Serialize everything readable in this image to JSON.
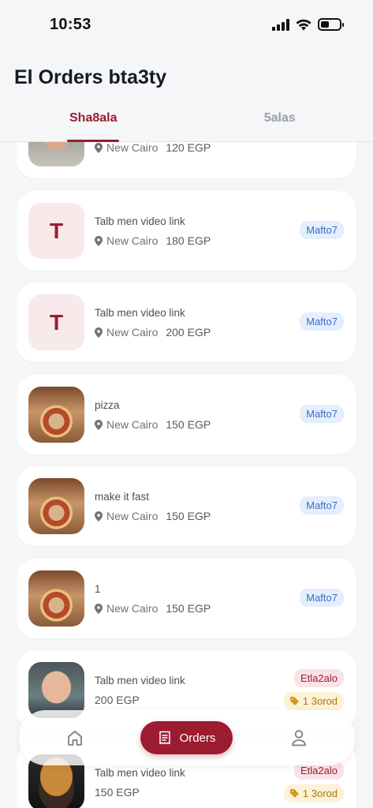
{
  "status_bar": {
    "time": "10:53"
  },
  "header": {
    "title": "El Orders bta3ty"
  },
  "tabs": [
    {
      "label": "Sha8ala",
      "active": true
    },
    {
      "label": "5alas",
      "active": false
    }
  ],
  "orders": [
    {
      "title": "",
      "location": "New Cairo",
      "price": "120 EGP",
      "thumb": "face",
      "status": "",
      "tag": ""
    },
    {
      "title": "Talb men video link",
      "location": "New Cairo",
      "price": "180 EGP",
      "thumb": "letter",
      "thumb_letter": "T",
      "status": "Mafto7",
      "tag": ""
    },
    {
      "title": "Talb men video link",
      "location": "New Cairo",
      "price": "200 EGP",
      "thumb": "letter",
      "thumb_letter": "T",
      "status": "Mafto7",
      "tag": ""
    },
    {
      "title": "pizza",
      "location": "New Cairo",
      "price": "150 EGP",
      "thumb": "pizza",
      "status": "Mafto7",
      "tag": ""
    },
    {
      "title": "make it fast",
      "location": "New Cairo",
      "price": "150 EGP",
      "thumb": "pizza",
      "status": "Mafto7",
      "tag": ""
    },
    {
      "title": "1",
      "location": "New Cairo",
      "price": "150 EGP",
      "thumb": "pizza",
      "status": "Mafto7",
      "tag": ""
    },
    {
      "title": "Talb men video link",
      "location": "",
      "price": "200 EGP",
      "thumb": "face",
      "status": "Etla2alo",
      "tag": "1 3orod"
    },
    {
      "title": "Talb men video link",
      "location": "",
      "price": "150 EGP",
      "thumb": "burger",
      "status": "Etla2alo",
      "tag": "1 3orod"
    }
  ],
  "bottom_nav": {
    "orders_label": "Orders"
  },
  "colors": {
    "accent": "#9b1c31",
    "open_badge": "#3a6fc4",
    "taken_badge": "#9b1c31",
    "offers_badge": "#a97b10"
  },
  "icons": [
    "home-icon",
    "orders-icon",
    "profile-icon",
    "location-pin-icon",
    "tag-icon",
    "signal-icon",
    "wifi-icon",
    "battery-icon"
  ]
}
